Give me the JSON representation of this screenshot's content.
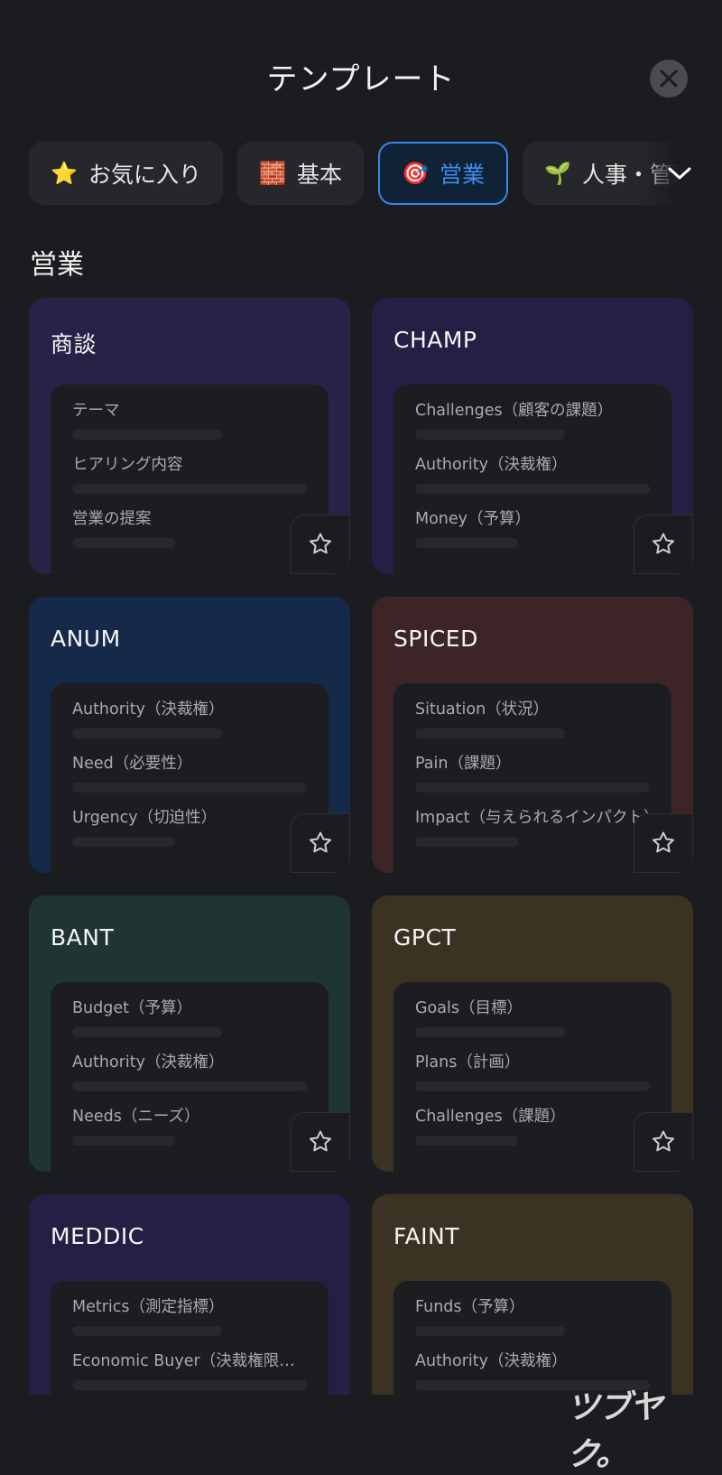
{
  "header": {
    "title": "テンプレート",
    "close_icon": "close-icon"
  },
  "tabs": [
    {
      "icon": "⭐",
      "label": "お気に入り",
      "active": false
    },
    {
      "icon": "🧱",
      "label": "基本",
      "active": false
    },
    {
      "icon": "🎯",
      "label": "営業",
      "active": true
    },
    {
      "icon": "🌱",
      "label": "人事・管理",
      "active": false
    }
  ],
  "section": {
    "title": "営業"
  },
  "cards": [
    {
      "title": "商談",
      "color": "#2a2147",
      "fields": [
        "テーマ",
        "ヒアリング内容",
        "営業の提案"
      ]
    },
    {
      "title": "CHAMP",
      "color": "#231f45",
      "fields": [
        "Challenges（顧客の課題）",
        "Authority（決裁権）",
        "Money（予算）"
      ]
    },
    {
      "title": "ANUM",
      "color": "#152a48",
      "fields": [
        "Authority（決裁権）",
        "Need（必要性）",
        "Urgency（切迫性）"
      ]
    },
    {
      "title": "SPICED",
      "color": "#3d2527",
      "fields": [
        "Situation（状況）",
        "Pain（課題）",
        "Impact（与えられるインパクト）"
      ]
    },
    {
      "title": "BANT",
      "color": "#1e3534",
      "fields": [
        "Budget（予算）",
        "Authority（決裁権）",
        "Needs（ニーズ）"
      ]
    },
    {
      "title": "GPCT",
      "color": "#3b3222",
      "fields": [
        "Goals（目標）",
        "Plans（計画）",
        "Challenges（課題）"
      ]
    },
    {
      "title": "MEDDIC",
      "color": "#261f45",
      "fields": [
        "Metrics（測定指標）",
        "Economic Buyer（決裁権限…",
        ""
      ]
    },
    {
      "title": "FAINT",
      "color": "#3b3224",
      "fields": [
        "Funds（予算）",
        "Authority（決裁権）",
        ""
      ]
    }
  ],
  "watermark": "ツブヤク。"
}
